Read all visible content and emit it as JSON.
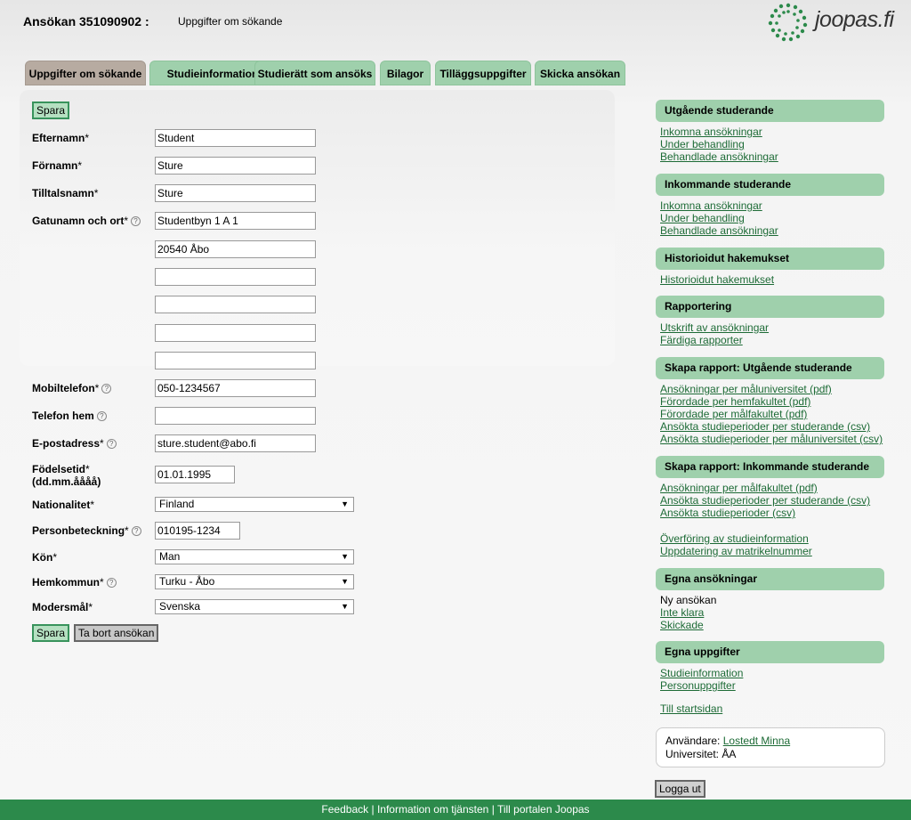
{
  "header": {
    "title": "Ansökan 351090902 :",
    "subtitle": "Uppgifter om sökande",
    "logo_text": "joopas.fi",
    "accent_color": "#2c8a4b"
  },
  "tabs": [
    {
      "label": "Uppgifter om sökande",
      "active": true
    },
    {
      "label": "Studieinformation",
      "active": false
    },
    {
      "label": "Studierätt som ansöks",
      "active": false
    },
    {
      "label": "Bilagor",
      "active": false
    },
    {
      "label": "Tilläggsuppgifter",
      "active": false
    },
    {
      "label": "Skicka ansökan",
      "active": false
    }
  ],
  "form": {
    "save_label": "Spara",
    "delete_label": "Ta bort ansökan",
    "lastname": {
      "label": "Efternamn",
      "value": "Student"
    },
    "firstnames": {
      "label": "Förnamn",
      "value": "Sture"
    },
    "callname": {
      "label": "Tilltalsnamn",
      "value": "Sture"
    },
    "address": {
      "label": "Gatunamn och ort",
      "lines": [
        "Studentbyn 1 A 1",
        "20540 Åbo",
        "",
        "",
        "",
        ""
      ]
    },
    "mobile": {
      "label": "Mobiltelefon",
      "value": "050-1234567"
    },
    "homephone": {
      "label": "Telefon hem",
      "value": ""
    },
    "email": {
      "label": "E-postadress",
      "value": "sture.student@abo.fi"
    },
    "birthdate": {
      "label": "Födelsetid",
      "format": "(dd.mm.åååå)",
      "value": "01.01.1995"
    },
    "nationality": {
      "label": "Nationalitet",
      "value": "Finland"
    },
    "ssn": {
      "label": "Personbeteckning",
      "value": "010195-1234"
    },
    "gender": {
      "label": "Kön",
      "value": "Man"
    },
    "municipality": {
      "label": "Hemkommun",
      "value": "Turku - Åbo"
    },
    "language": {
      "label": "Modersmål",
      "value": "Svenska"
    },
    "required_mark": "*"
  },
  "sidebar": {
    "outgoing": {
      "title": "Utgående studerande",
      "links": [
        "Inkomna ansökningar",
        "Under behandling",
        "Behandlade ansökningar"
      ]
    },
    "incoming": {
      "title": "Inkommande studerande",
      "links": [
        "Inkomna ansökningar",
        "Under behandling",
        "Behandlade ansökningar"
      ]
    },
    "history": {
      "title": "Historioidut hakemukset",
      "links": [
        "Historioidut hakemukset"
      ]
    },
    "reporting": {
      "title": "Rapportering",
      "links": [
        "Utskrift av ansökningar",
        "Färdiga rapporter"
      ]
    },
    "report_out": {
      "title": "Skapa rapport: Utgående studerande",
      "links": [
        "Ansökningar per måluniversitet (pdf)",
        "Förordade per hemfakultet (pdf)",
        "Förordade per målfakultet (pdf)",
        "Ansökta studieperioder per studerande (csv)",
        "Ansökta studieperioder per måluniversitet (csv)"
      ]
    },
    "report_in": {
      "title": "Skapa rapport: Inkommande studerande",
      "links": [
        "Ansökningar per målfakultet (pdf)",
        "Ansökta studieperioder per studerande (csv)",
        "Ansökta studieperioder (csv)"
      ]
    },
    "transfer_links": [
      "Överföring av studieinformation",
      "Uppdatering av matrikelnummer"
    ],
    "own_apps": {
      "title": "Egna ansökningar",
      "new_text": "Ny ansökan",
      "links": [
        "Inte klara",
        "Skickade"
      ]
    },
    "own_info": {
      "title": "Egna uppgifter",
      "links": [
        "Studieinformation",
        "Personuppgifter"
      ]
    },
    "home_link": "Till startsidan",
    "user_label": "Användare:",
    "user_name": "Lostedt Minna",
    "uni_label": "Universitet:",
    "uni_value": "ÅA",
    "logout_label": "Logga ut"
  },
  "footer": {
    "feedback": "Feedback",
    "info": "Information om tjänsten",
    "portal": "Till portalen Joopas",
    "separator": "|"
  }
}
